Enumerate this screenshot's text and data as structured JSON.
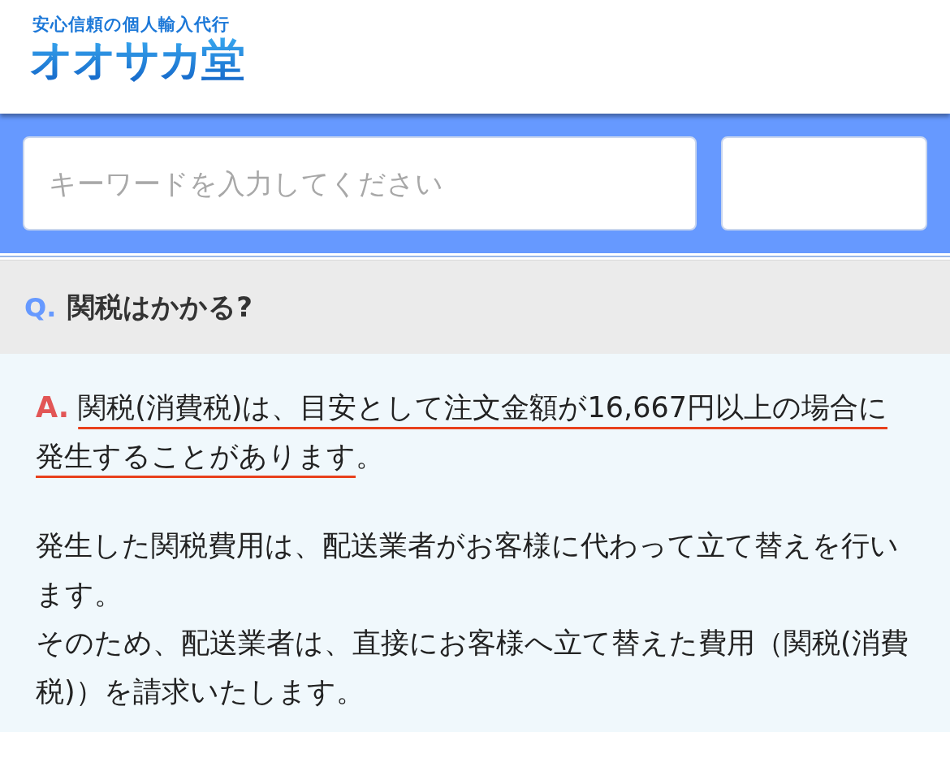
{
  "header": {
    "tagline": "安心信頼の個人輸入代行",
    "logo": "オオサカ堂"
  },
  "search": {
    "placeholder": "キーワードを入力してください"
  },
  "faq": {
    "question_mark": "Q.",
    "question": "関税はかかる?",
    "answer_mark": "A.",
    "answer_underlined": "関税(消費税)は、目安として注文金額が16,667円以上の場合に発生することがあります",
    "answer_rest": "。",
    "paragraphs": [
      "発生した関税費用は、配送業者がお客様に代わって立て替えを行います。",
      "そのため、配送業者は、直接にお客様へ立て替えた費用（関税(消費税)）を請求いたします。"
    ]
  }
}
